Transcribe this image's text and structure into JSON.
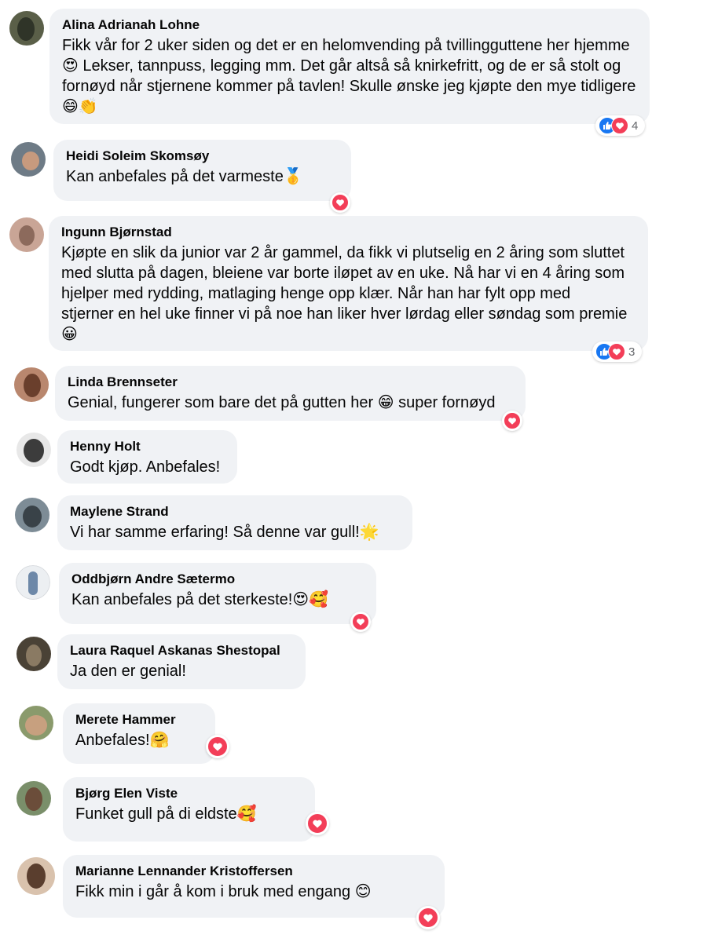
{
  "colors": {
    "bubble": "#f0f2f5",
    "like": "#1877f2",
    "love": "#f33e58",
    "muted_text": "#65676b"
  },
  "comments": [
    {
      "author": "Alina Adrianah Lohne",
      "text": "Fikk vår for 2 uker siden og det er en helomvending på tvillingguttene her hjemme\n😍 Lekser, tannpuss, legging mm. Det går altså så knirkefritt, og de er så stolt og\nfornøyd når stjernene kommer på tavlen! Skulle ønske jeg kjøpte den mye tidligere\n😄👏",
      "reactions": [
        "like",
        "love"
      ],
      "count": "4"
    },
    {
      "author": "Heidi Soleim Skomsøy",
      "text": "Kan anbefales på det varmeste🥇",
      "reactions": [
        "love"
      ],
      "count": ""
    },
    {
      "author": "Ingunn Bjørnstad",
      "text": "Kjøpte en slik da junior var 2 år gammel, da fikk vi plutselig en 2 åring som sluttet\nmed slutta på dagen, bleiene var borte iløpet av en uke. Nå har vi en 4 åring som\nhjelper med rydding, matlaging henge opp klær. Når han har fylt opp med\nstjerner en hel uke finner vi på noe han liker hver lørdag eller søndag som premie\n😀",
      "reactions": [
        "like",
        "love"
      ],
      "count": "3"
    },
    {
      "author": "Linda Brennseter",
      "text": "Genial, fungerer som bare det på gutten her 😁 super fornøyd",
      "reactions": [
        "love"
      ],
      "count": ""
    },
    {
      "author": "Henny Holt",
      "text": "Godt kjøp. Anbefales!",
      "reactions": [],
      "count": ""
    },
    {
      "author": "Maylene Strand",
      "text": "Vi har samme erfaring! Så denne var gull!🌟",
      "reactions": [],
      "count": ""
    },
    {
      "author": "Oddbjørn Andre Sætermo",
      "text": "Kan anbefales på det sterkeste!😍🥰",
      "reactions": [
        "love"
      ],
      "count": ""
    },
    {
      "author": "Laura Raquel Askanas Shestopal",
      "text": "Ja den er genial!",
      "reactions": [],
      "count": ""
    },
    {
      "author": "Merete Hammer",
      "text": "Anbefales!🤗",
      "reactions": [
        "love"
      ],
      "count": ""
    },
    {
      "author": "Bjørg Elen Viste",
      "text": "Funket gull på di eldste🥰",
      "reactions": [
        "love"
      ],
      "count": ""
    },
    {
      "author": "Marianne Lennander Kristoffersen",
      "text": "Fikk min i går å kom i bruk med engang 😊",
      "reactions": [
        "love"
      ],
      "count": ""
    }
  ]
}
